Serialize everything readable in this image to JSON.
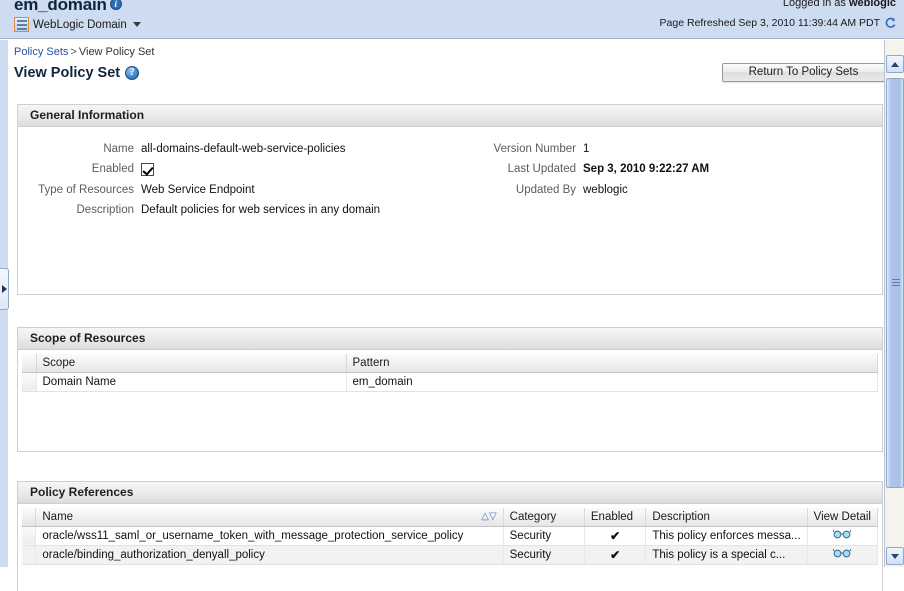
{
  "banner": {
    "domain_name": "em_domain",
    "info_icon": "info-icon",
    "target_label": "WebLogic Domain",
    "target_icon": "weblogic-domain-icon",
    "logged_in_prefix": "Logged in as",
    "logged_in_user": "weblogic",
    "page_refreshed": "Page Refreshed Sep 3, 2010 11:39:44 AM PDT",
    "refresh_icon": "refresh-icon"
  },
  "breadcrumb": {
    "link": "Policy Sets",
    "separator": ">",
    "current": "View Policy Set"
  },
  "page": {
    "title": "View Policy Set",
    "help_icon": "help-icon",
    "return_button": "Return To Policy Sets"
  },
  "general_information": {
    "header": "General Information",
    "left_fields": [
      {
        "label": "Name",
        "value": "all-domains-default-web-service-policies"
      },
      {
        "label": "Enabled",
        "value": "",
        "type": "checkbox",
        "checked": true
      },
      {
        "label": "Type of Resources",
        "value": "Web Service Endpoint"
      },
      {
        "label": "Description",
        "value": "Default policies for web services in any domain"
      }
    ],
    "right_fields": [
      {
        "label": "Version Number",
        "value": "1"
      },
      {
        "label": "Last Updated",
        "value": "Sep 3, 2010 9:22:27 AM"
      },
      {
        "label": "Updated By",
        "value": "weblogic"
      }
    ]
  },
  "scope_of_resources": {
    "header": "Scope of Resources",
    "columns": [
      "Scope",
      "Pattern"
    ],
    "rows": [
      {
        "scope": "Domain Name",
        "pattern": "em_domain"
      }
    ]
  },
  "policy_references": {
    "header": "Policy References",
    "columns": [
      "Name",
      "Category",
      "Enabled",
      "Description",
      "View Detail"
    ],
    "sort_arrows": "△▽",
    "rows": [
      {
        "name": "oracle/wss11_saml_or_username_token_with_message_protection_service_policy",
        "category": "Security",
        "enabled": "✔",
        "description": "This policy enforces messa...",
        "view_detail_icon": "glasses-icon"
      },
      {
        "name": "oracle/binding_authorization_denyall_policy",
        "category": "Security",
        "enabled": "✔",
        "description": "This policy is a special c...",
        "view_detail_icon": "glasses-icon"
      }
    ]
  },
  "scrollbar": {
    "up_icon": "scroll-up-icon",
    "down_icon": "scroll-down-icon",
    "thumb": "scrollbar-thumb"
  },
  "left_panel_toggle": {
    "icon": "expand-left-panel-icon"
  },
  "colors": {
    "banner_bg": "#cddcf0",
    "link": "#2554a0",
    "title": "#11243d",
    "tick": "#1f5fa8",
    "glasses": "#7fc9e8"
  }
}
